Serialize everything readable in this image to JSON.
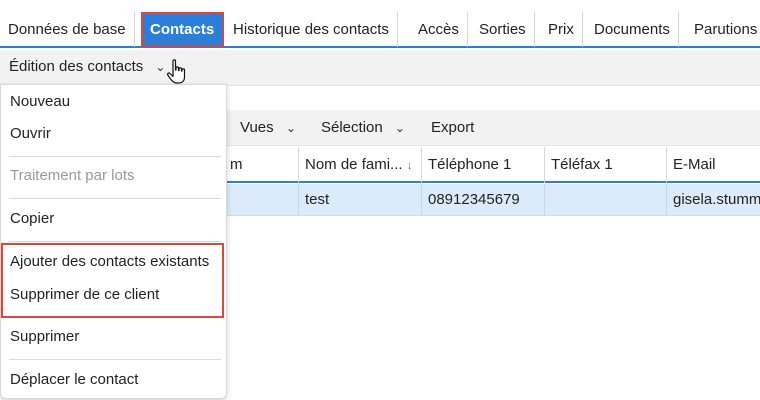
{
  "tabs": [
    {
      "label": "Données de base"
    },
    {
      "label": "Contacts",
      "active": true
    },
    {
      "label": "Historique des contacts"
    },
    {
      "label": "Accès"
    },
    {
      "label": "Sorties"
    },
    {
      "label": "Prix"
    },
    {
      "label": "Documents"
    },
    {
      "label": "Parutions"
    }
  ],
  "edit": {
    "label": "Édition des contacts"
  },
  "menu": {
    "nouveau": "Nouveau",
    "ouvrir": "Ouvrir",
    "traitement": "Traitement par lots",
    "copier": "Copier",
    "ajouter": "Ajouter des contacts existants",
    "supprimer_client": "Supprimer de ce client",
    "supprimer": "Supprimer",
    "deplacer": "Déplacer le contact"
  },
  "toolbar": {
    "vues": "Vues",
    "selection": "Sélection",
    "export": "Export"
  },
  "table": {
    "headers": {
      "prenom_partial": "m",
      "nom": "Nom de fami...",
      "tel": "Téléphone 1",
      "fax": "Téléfax 1",
      "email": "E-Mail"
    },
    "row": {
      "nom": "test",
      "tel": "08912345679",
      "fax": "",
      "email": "gisela.stumm"
    }
  },
  "colors": {
    "accent": "#2b7fd8",
    "highlight": "#e0453c",
    "row_selected": "#dcebfa"
  }
}
